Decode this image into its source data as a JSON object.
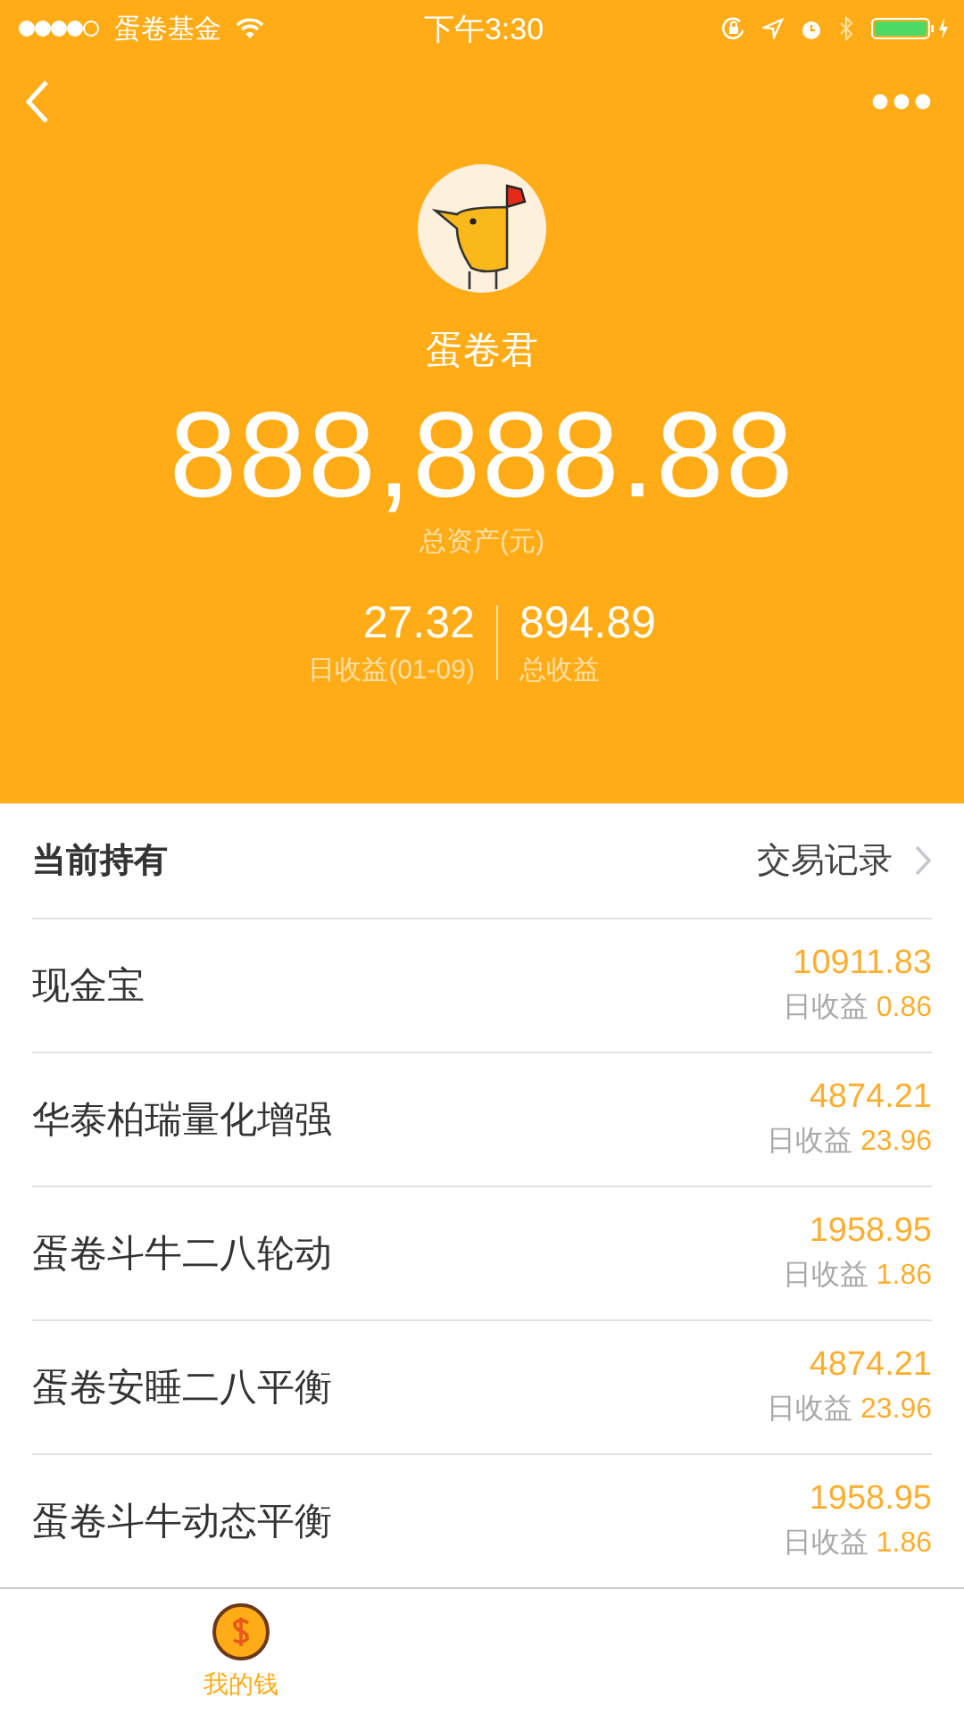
{
  "status_bar": {
    "carrier": "蛋卷基金",
    "time": "下午3:30"
  },
  "profile": {
    "name": "蛋卷君",
    "total_assets": "888,888.88",
    "total_assets_label": "总资产(元)",
    "daily_income": "27.32",
    "daily_income_label": "日收益(01-09)",
    "total_income": "894.89",
    "total_income_label": "总收益"
  },
  "holdings": {
    "title": "当前持有",
    "link": "交易记录",
    "items": [
      {
        "name": "现金宝",
        "amount": "10911.83",
        "daily_label": "日收益",
        "daily_value": "0.86"
      },
      {
        "name": "华泰柏瑞量化增强",
        "amount": "4874.21",
        "daily_label": "日收益",
        "daily_value": "23.96"
      },
      {
        "name": "蛋卷斗牛二八轮动",
        "amount": "1958.95",
        "daily_label": "日收益",
        "daily_value": "1.86"
      },
      {
        "name": "蛋卷安睡二八平衡",
        "amount": "4874.21",
        "daily_label": "日收益",
        "daily_value": "23.96"
      },
      {
        "name": "蛋卷斗牛动态平衡",
        "amount": "1958.95",
        "daily_label": "日收益",
        "daily_value": "1.86"
      }
    ]
  },
  "tab_bar": [
    {
      "label": "我的钱",
      "selected": true
    }
  ]
}
